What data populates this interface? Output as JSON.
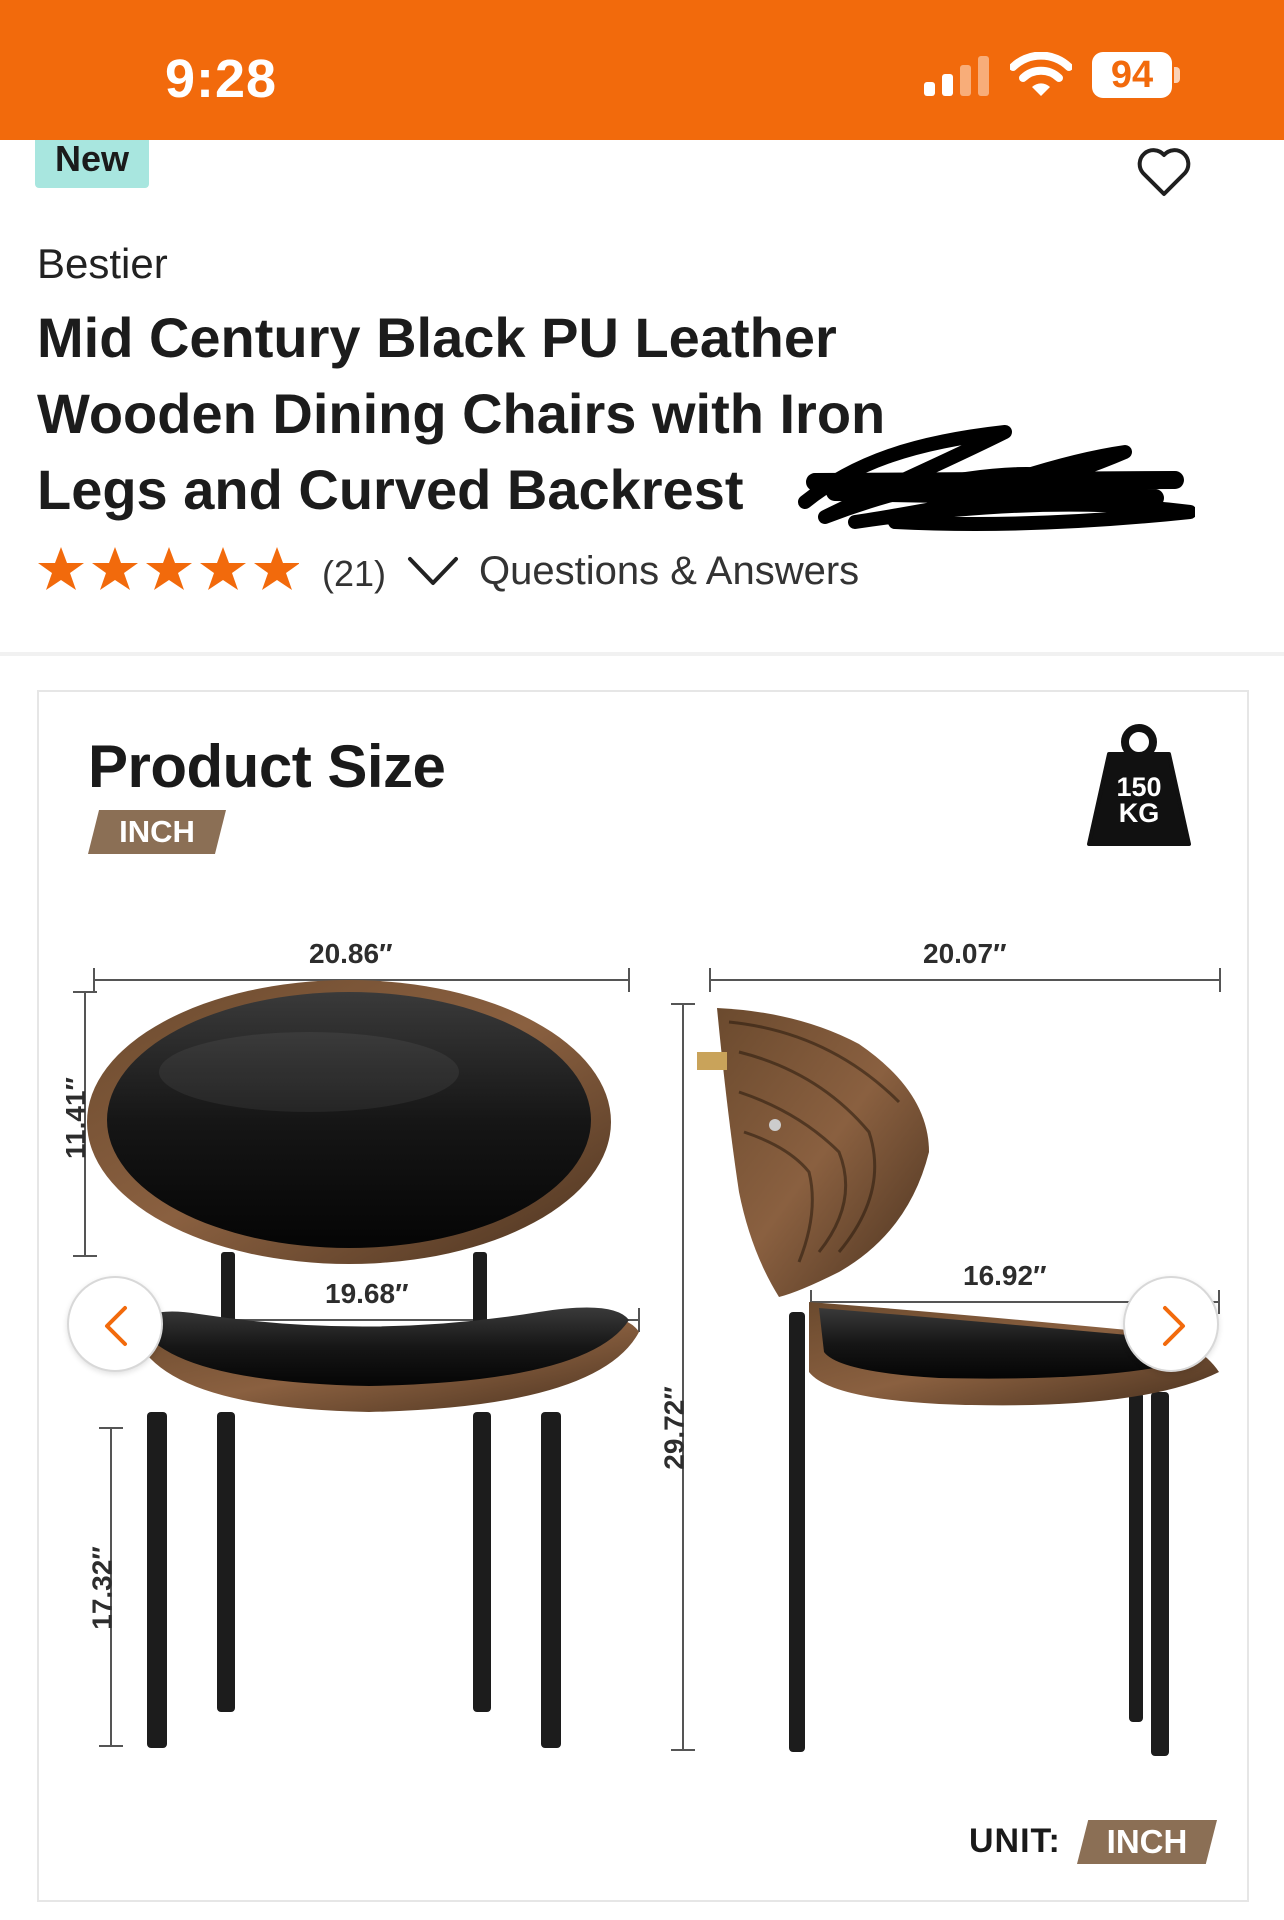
{
  "status_bar": {
    "time": "9:28",
    "battery": "94",
    "icons": [
      "signal-icon",
      "wifi-icon",
      "battery-icon"
    ]
  },
  "product": {
    "badge": "New",
    "brand": "Bestier",
    "title": "Mid Century Black PU Leather Wooden Dining Chairs with Iron Legs and Curved Backrest",
    "rating_count": "(21)",
    "qa_link": "Questions & Answers",
    "star_color": "#f26a0c"
  },
  "image": {
    "title": "Product Size",
    "unit_tag": "INCH",
    "weight_line1": "150",
    "weight_line2": "KG",
    "dims": {
      "front_width": "20.86″",
      "back_height": "11.41″",
      "seat_width": "19.68″",
      "seat_height": "17.32″",
      "total_height": "29.72″",
      "side_depth": "20.07″",
      "seat_depth": "16.92″"
    },
    "unit_label": "UNIT:",
    "unit_value": "INCH"
  },
  "colors": {
    "brand_orange": "#f26a0c",
    "badge_teal": "#a8e6df",
    "tag_brown": "#8b6f55"
  }
}
